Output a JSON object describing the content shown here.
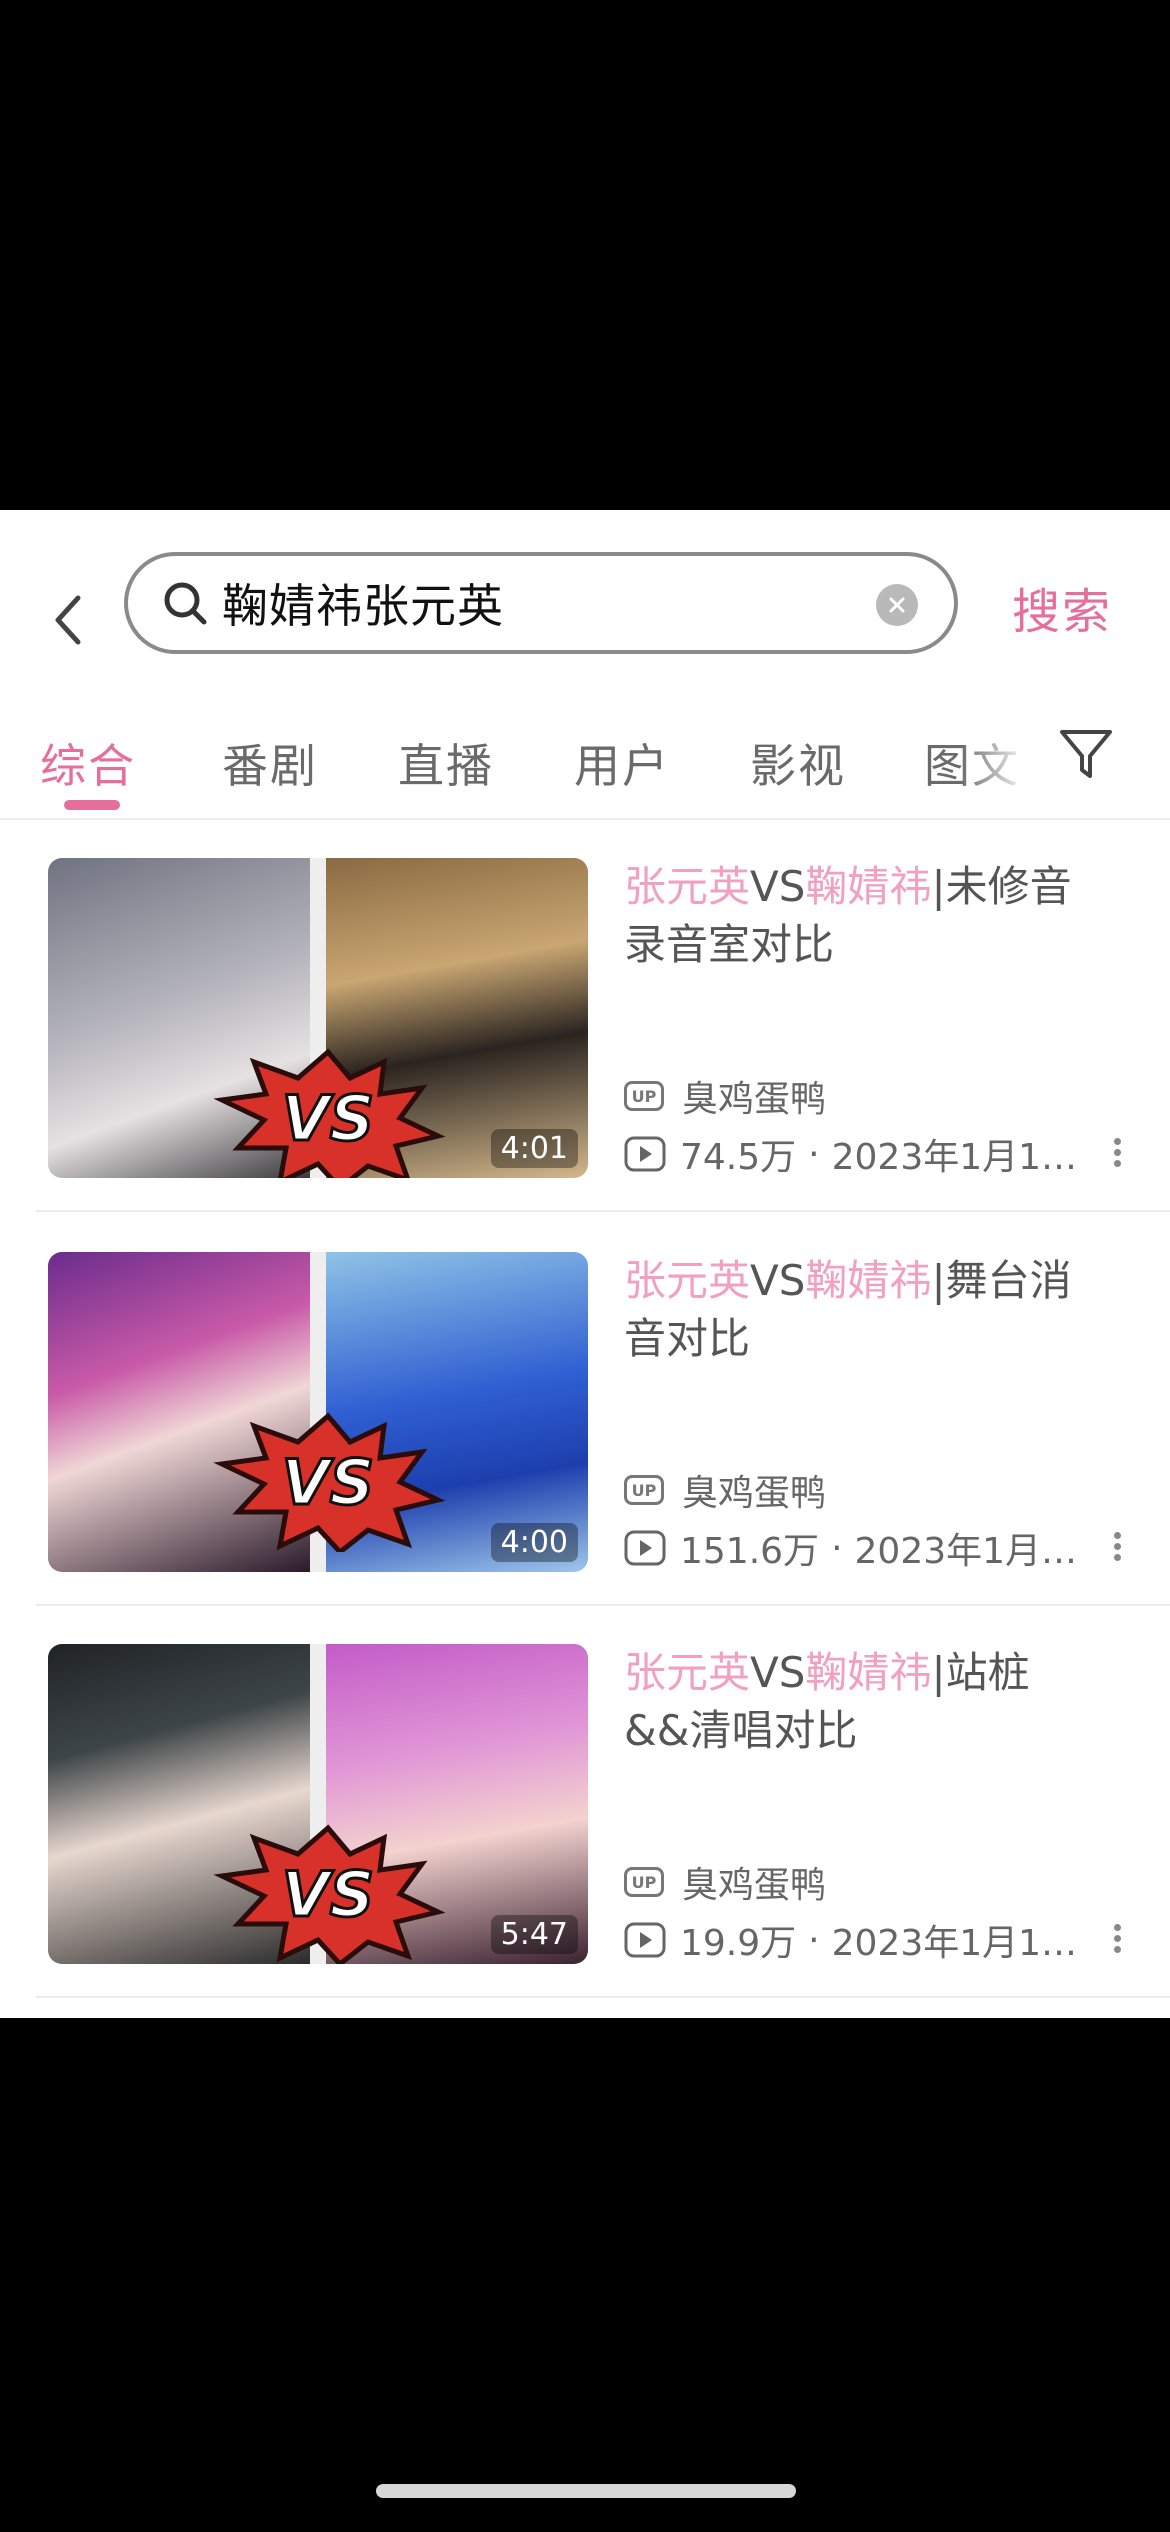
{
  "search": {
    "query": "鞠婧祎张元英",
    "button_label": "搜索"
  },
  "tabs": [
    {
      "label": "综合",
      "active": true
    },
    {
      "label": "番剧",
      "active": false
    },
    {
      "label": "直播",
      "active": false
    },
    {
      "label": "用户",
      "active": false
    },
    {
      "label": "影视",
      "active": false
    },
    {
      "label": "图文",
      "active": false
    }
  ],
  "results": [
    {
      "title_hl1": "张元英",
      "title_vs": "VS",
      "title_hl2": "鞠婧祎",
      "title_rest_line1": "|未修音",
      "title_line2": "录音室对比",
      "uploader": "臭鸡蛋鸭",
      "views": "74.5万",
      "date": "2023年1月1…",
      "duration": "4:01",
      "vs_text": "VS"
    },
    {
      "title_hl1": "张元英",
      "title_vs": "VS",
      "title_hl2": "鞠婧祎",
      "title_rest_line1": "|舞台消",
      "title_line2": "音对比",
      "uploader": "臭鸡蛋鸭",
      "views": "151.6万",
      "date": "2023年1月…",
      "duration": "4:00",
      "vs_text": "VS"
    },
    {
      "title_hl1": "张元英",
      "title_vs": "VS",
      "title_hl2": "鞠婧祎",
      "title_rest_line1": "|站桩",
      "title_line2": "&&清唱对比",
      "uploader": "臭鸡蛋鸭",
      "views": "19.9万",
      "date": "2023年1月1…",
      "duration": "5:47",
      "vs_text": "VS"
    }
  ],
  "badges": {
    "up": "UP"
  },
  "colors": {
    "accent": "#e66f9a",
    "highlight": "#f2a0bf"
  },
  "icons": [
    "back-arrow-icon",
    "search-icon",
    "clear-icon",
    "filter-icon",
    "up-badge-icon",
    "play-count-icon",
    "more-icon"
  ]
}
